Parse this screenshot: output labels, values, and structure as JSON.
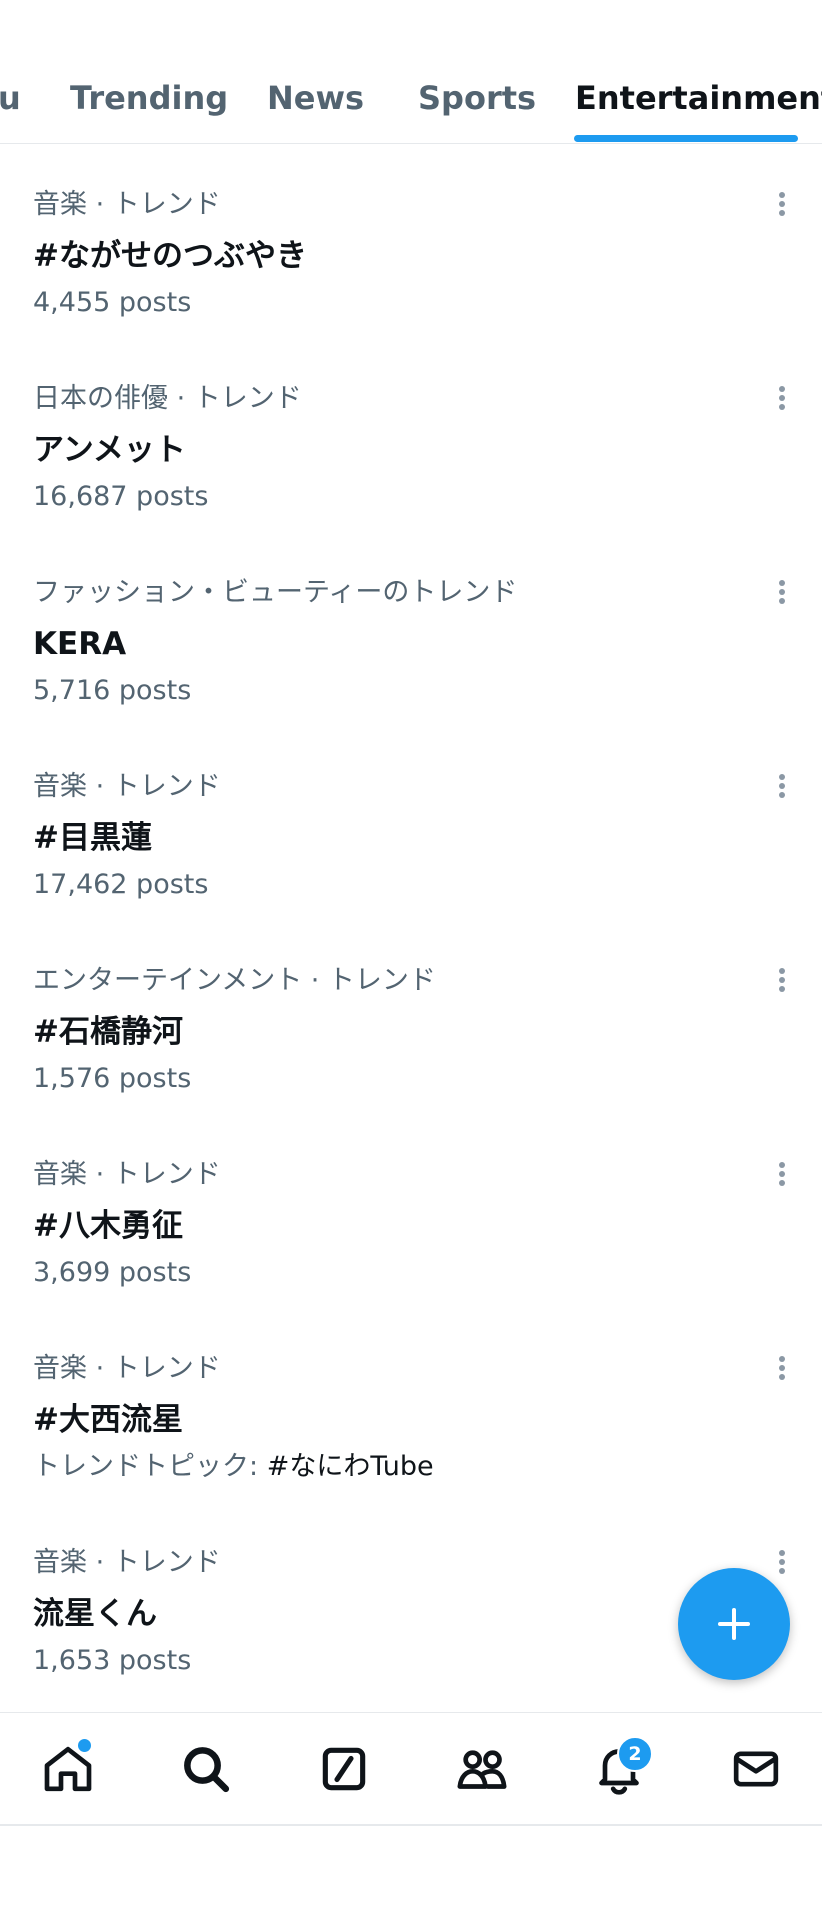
{
  "tabs": [
    {
      "label": "u",
      "active": false
    },
    {
      "label": "Trending",
      "active": false
    },
    {
      "label": "News",
      "active": false
    },
    {
      "label": "Sports",
      "active": false
    },
    {
      "label": "Entertainment",
      "active": true
    }
  ],
  "trends": [
    {
      "category": "音楽 · トレンド",
      "name": "#ながせのつぶやき",
      "posts": "4,455 posts"
    },
    {
      "category": "日本の俳優 · トレンド",
      "name": "アンメット",
      "posts": "16,687 posts"
    },
    {
      "category": "ファッション・ビューティーのトレンド",
      "name": "KERA",
      "posts": "5,716 posts"
    },
    {
      "category": "音楽 · トレンド",
      "name": "#目黒蓮",
      "posts": "17,462 posts"
    },
    {
      "category": "エンターテインメント · トレンド",
      "name": "#石橋静河",
      "posts": "1,576 posts"
    },
    {
      "category": "音楽 · トレンド",
      "name": "#八木勇征",
      "posts": "3,699 posts"
    },
    {
      "category": "音楽 · トレンド",
      "name": "#大西流星",
      "topic_label": "トレンドトピック:",
      "topic_value": "#なにわTube"
    },
    {
      "category": "音楽 · トレンド",
      "name": "流星くん",
      "posts": "1,653 posts"
    }
  ],
  "fab": {
    "icon": "plus-icon"
  },
  "bottom_nav": {
    "items": [
      {
        "icon": "home-icon",
        "has_dot": true
      },
      {
        "icon": "search-icon"
      },
      {
        "icon": "grok-icon"
      },
      {
        "icon": "communities-icon"
      },
      {
        "icon": "notifications-icon",
        "badge": "2"
      },
      {
        "icon": "messages-icon"
      }
    ],
    "notification_count": "2"
  },
  "colors": {
    "accent": "#1d9bf0",
    "text_primary": "#0f1419",
    "text_secondary": "#536471"
  }
}
